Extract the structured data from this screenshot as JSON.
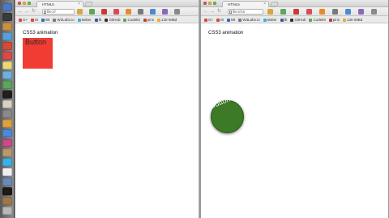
{
  "colors": {
    "square": "#f03c33",
    "circle": "#3c7a27",
    "traffic_close": "#e8544a",
    "traffic_min": "#e9b43a",
    "traffic_max": "#67c04c"
  },
  "dock": {
    "icons": [
      {
        "name": "finder-icon",
        "color": "#4a79c4"
      },
      {
        "name": "dashboard-icon",
        "color": "#3a3a3a"
      },
      {
        "name": "mail-icon",
        "color": "#c89040"
      },
      {
        "name": "safari-icon",
        "color": "#5a9fd8"
      },
      {
        "name": "chrome-icon",
        "color": "#d44a3c"
      },
      {
        "name": "calendar-icon",
        "color": "#e04848"
      },
      {
        "name": "notes-icon",
        "color": "#e8d878"
      },
      {
        "name": "itunes-icon",
        "color": "#6ab0e0"
      },
      {
        "name": "photos-icon",
        "color": "#5aa85a"
      },
      {
        "name": "terminal-icon",
        "color": "#1f1f1f"
      },
      {
        "name": "text-editor-icon",
        "color": "#d8d0c0"
      },
      {
        "name": "preferences-icon",
        "color": "#8a8a8a"
      },
      {
        "name": "folder-icon",
        "color": "#e0a040"
      },
      {
        "name": "app-store-icon",
        "color": "#4a8ad8"
      },
      {
        "name": "music-icon",
        "color": "#c84a8a"
      },
      {
        "name": "contacts-icon",
        "color": "#b89a6a"
      },
      {
        "name": "skype-icon",
        "color": "#3ab0e8"
      },
      {
        "name": "document-icon",
        "color": "#f0f0f0"
      },
      {
        "name": "downloads-icon",
        "color": "#6a8ab8"
      },
      {
        "name": "media-icon",
        "color": "#1a1a1a"
      },
      {
        "name": "stack-icon",
        "color": "#a07848"
      },
      {
        "name": "trash-icon",
        "color": "#b8b8b8"
      }
    ]
  },
  "left_window": {
    "tab_title": "HTML5",
    "tab_close": "×",
    "address": "file:///",
    "bookmarks": [
      {
        "label": "G+",
        "icon": "googleplus-icon",
        "color": "#d44a3c"
      },
      {
        "label": "M",
        "icon": "gmail-icon",
        "color": "#d44a3c"
      },
      {
        "label": "Wt",
        "icon": "site-icon",
        "color": "#3a6ab8"
      },
      {
        "label": "W3Labs.io",
        "icon": "w3labs-icon",
        "color": "#7a7a7a"
      },
      {
        "label": "twitter",
        "icon": "twitter-icon",
        "color": "#3ab0e8"
      },
      {
        "label": "fb",
        "icon": "facebook-icon",
        "color": "#3a5a98"
      },
      {
        "label": "GitHub",
        "icon": "github-icon",
        "color": "#333333"
      },
      {
        "label": "Codekit",
        "icon": "codekit-icon",
        "color": "#5aa85a"
      },
      {
        "label": "pins",
        "icon": "pin-icon",
        "color": "#c83a3a"
      },
      {
        "label": "130 IMBd",
        "icon": "imdb-icon",
        "color": "#e0b030"
      }
    ],
    "heading": "CSS3 animation",
    "button_label": "Button"
  },
  "right_window": {
    "tab_title": "HTML5",
    "tab_close": "×",
    "address": "file:///Ur",
    "bookmarks": [
      {
        "label": "G+",
        "icon": "googleplus-icon",
        "color": "#d44a3c"
      },
      {
        "label": "M",
        "icon": "gmail-icon",
        "color": "#d44a3c"
      },
      {
        "label": "Wt",
        "icon": "site-icon",
        "color": "#3a6ab8"
      },
      {
        "label": "W3Labs.io",
        "icon": "w3labs-icon",
        "color": "#7a7a7a"
      },
      {
        "label": "twitter",
        "icon": "twitter-icon",
        "color": "#3ab0e8"
      },
      {
        "label": "fb",
        "icon": "facebook-icon",
        "color": "#3a5a98"
      },
      {
        "label": "GitHub",
        "icon": "github-icon",
        "color": "#333333"
      },
      {
        "label": "Codekit",
        "icon": "codekit-icon",
        "color": "#5aa85a"
      },
      {
        "label": "pins",
        "icon": "pin-icon",
        "color": "#c83a3a"
      },
      {
        "label": "130 IMBd",
        "icon": "imdb-icon",
        "color": "#e0b030"
      }
    ],
    "heading": "CSS3 animation",
    "button_label": "Button"
  },
  "toolbar_icons": [
    {
      "name": "pencil-icon",
      "color": "#d9a63a"
    },
    {
      "name": "evernote-icon",
      "color": "#5aa85a"
    },
    {
      "name": "lastpass-icon",
      "color": "#c83a3a"
    },
    {
      "name": "pocket-icon",
      "color": "#d84a5a"
    },
    {
      "name": "rss-icon",
      "color": "#e88a2a"
    },
    {
      "name": "wrench-icon",
      "color": "#7a7a7a"
    },
    {
      "name": "colorpicker-icon",
      "color": "#4a8ad8"
    },
    {
      "name": "extension-icon",
      "color": "#8a6ab8"
    },
    {
      "name": "menu-icon",
      "color": "#8a8a8a"
    }
  ]
}
